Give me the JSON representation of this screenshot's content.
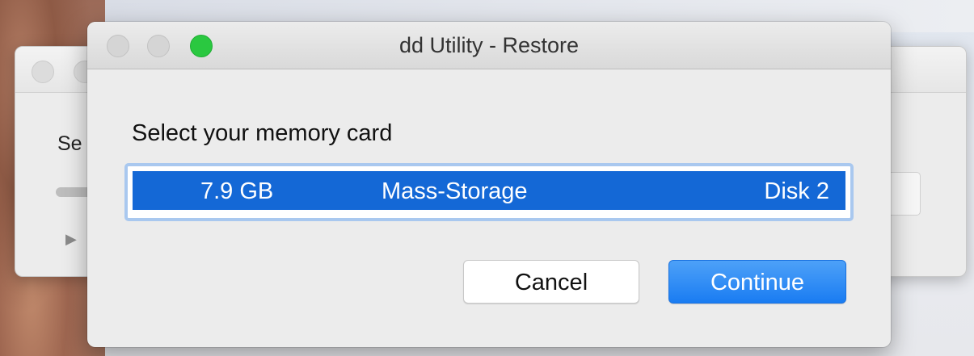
{
  "window": {
    "title": "dd Utility - Restore"
  },
  "background_window": {
    "partial_text": "Se",
    "disclosure_glyph": "▶"
  },
  "dialog": {
    "prompt": "Select your memory card",
    "device_list": {
      "selected_index": 0,
      "rows": [
        {
          "size": "7.9 GB",
          "type": "Mass-Storage",
          "disk": "Disk 2"
        }
      ]
    },
    "buttons": {
      "cancel": "Cancel",
      "continue": "Continue"
    }
  },
  "colors": {
    "selection": "#1468d6",
    "primary_button": "#1a7cf2",
    "zoom_light": "#2ac840",
    "focus_ring": "#a9c8ef"
  }
}
